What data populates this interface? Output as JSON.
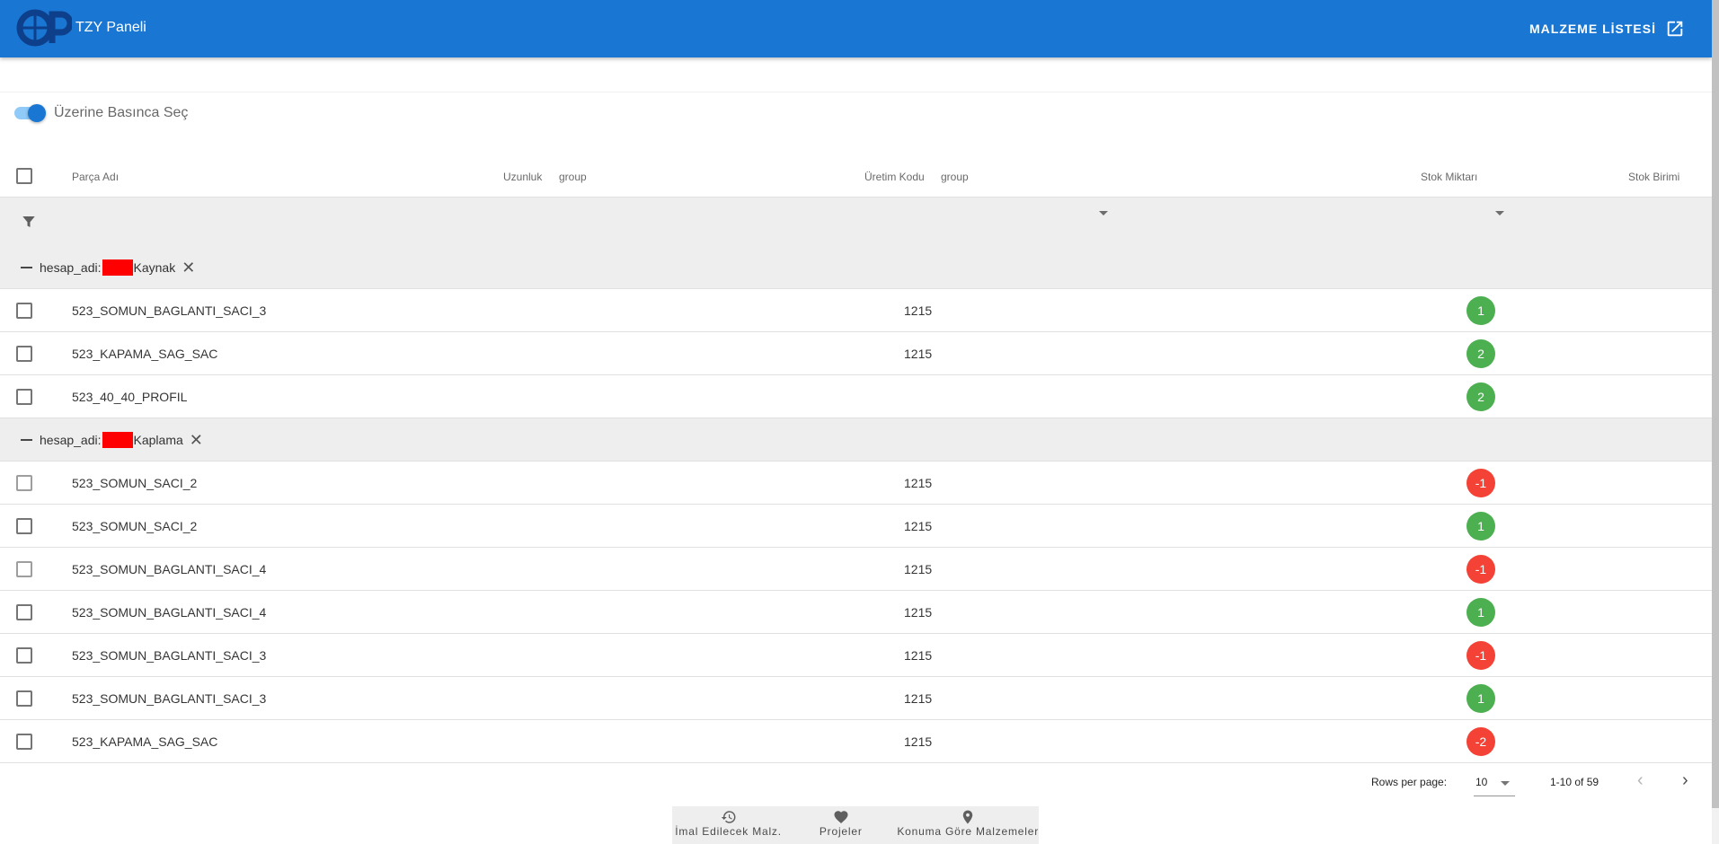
{
  "app": {
    "title": "TZY Paneli",
    "logo_text": "OP",
    "materials_button": "MALZEME LİSTESİ"
  },
  "toggle": {
    "label": "Üzerine Basınca Seç",
    "checked": true
  },
  "table": {
    "headers": {
      "part_name": "Parça Adı",
      "length": "Uzunluk",
      "length_group": "group",
      "prod_code": "Üretim Kodu",
      "prod_group": "group",
      "stock_qty": "Stok Miktarı",
      "stock_unit": "Stok Birimi"
    },
    "groups": [
      {
        "prefix": "hesap_adi:",
        "name": "Kaynak",
        "rows": [
          {
            "name": "523_SOMUN_BAGLANTI_SACI_3",
            "code": "1215",
            "stock": "1",
            "status": "positive"
          },
          {
            "name": "523_KAPAMA_SAG_SAC",
            "code": "1215",
            "stock": "2",
            "status": "positive"
          },
          {
            "name": "523_40_40_PROFIL",
            "code": "",
            "stock": "2",
            "status": "positive"
          }
        ]
      },
      {
        "prefix": "hesap_adi:",
        "name": "Kaplama",
        "rows": [
          {
            "name": "523_SOMUN_SACI_2",
            "code": "1215",
            "stock": "-1",
            "status": "negative"
          },
          {
            "name": "523_SOMUN_SACI_2",
            "code": "1215",
            "stock": "1",
            "status": "positive"
          },
          {
            "name": "523_SOMUN_BAGLANTI_SACI_4",
            "code": "1215",
            "stock": "-1",
            "status": "negative"
          },
          {
            "name": "523_SOMUN_BAGLANTI_SACI_4",
            "code": "1215",
            "stock": "1",
            "status": "positive"
          },
          {
            "name": "523_SOMUN_BAGLANTI_SACI_3",
            "code": "1215",
            "stock": "-1",
            "status": "negative"
          },
          {
            "name": "523_SOMUN_BAGLANTI_SACI_3",
            "code": "1215",
            "stock": "1",
            "status": "positive"
          },
          {
            "name": "523_KAPAMA_SAG_SAC",
            "code": "1215",
            "stock": "-2",
            "status": "negative"
          }
        ]
      }
    ]
  },
  "pagination": {
    "rows_per_page_label": "Rows per page:",
    "rows_per_page": "10",
    "range": "1-10 of 59"
  },
  "bottom_nav": [
    {
      "label": "İmal Edilecek Malz.",
      "icon": "history-icon"
    },
    {
      "label": "Projeler",
      "icon": "heart-icon"
    },
    {
      "label": "Konuma Göre Malzemeler",
      "icon": "location-pin-icon"
    }
  ],
  "colors": {
    "primary": "#1976d2",
    "positive": "#4caf50",
    "negative": "#f44336",
    "group_bg": "#eeeeee"
  }
}
